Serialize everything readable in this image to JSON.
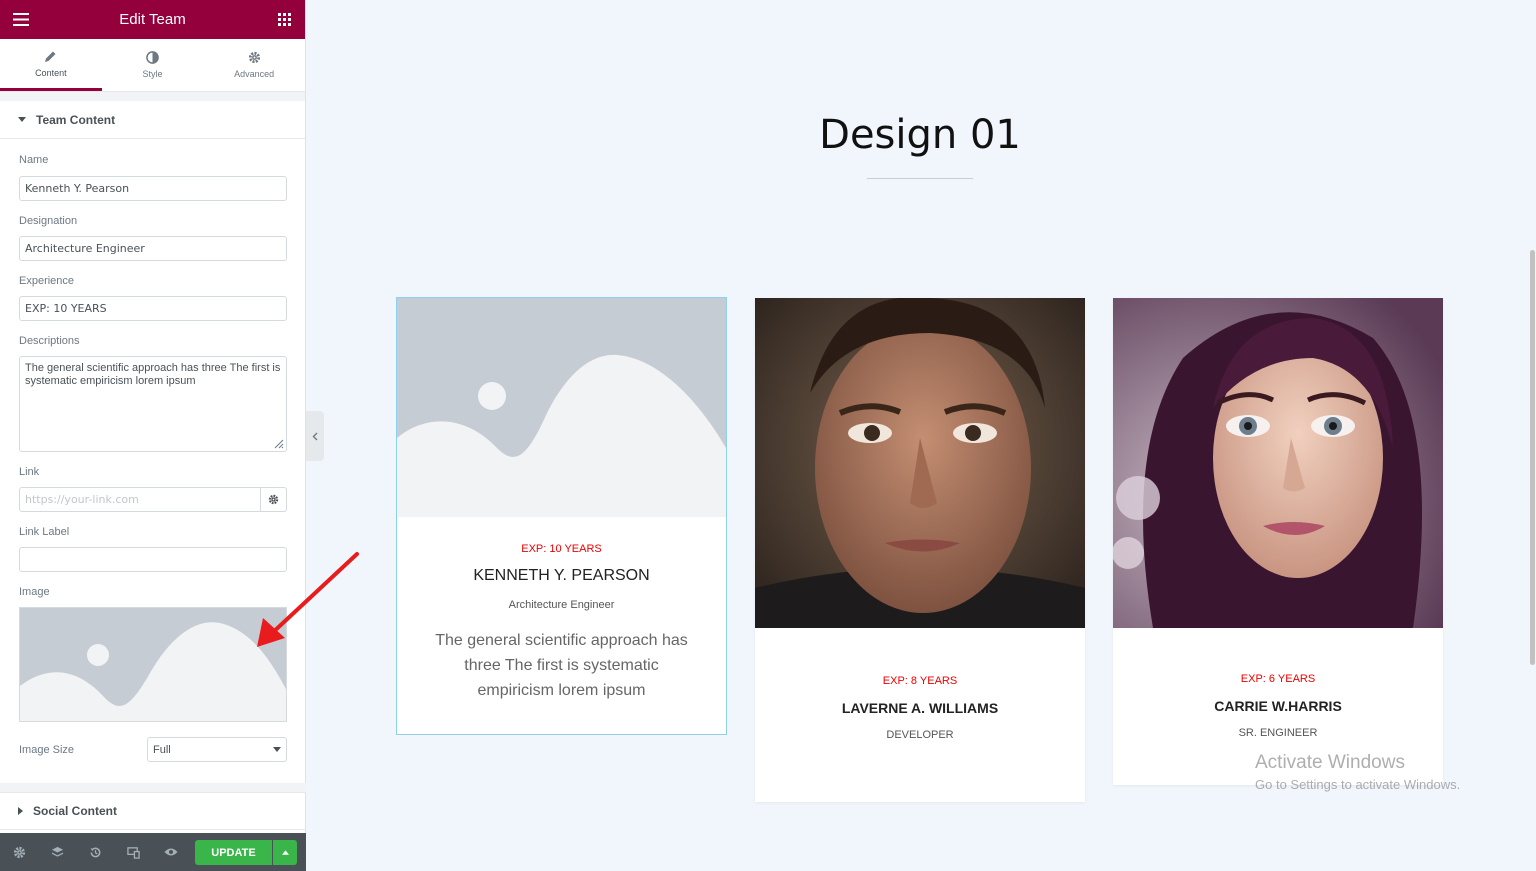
{
  "editor": {
    "title": "Edit Team",
    "tabs": [
      {
        "label": "Content"
      },
      {
        "label": "Style"
      },
      {
        "label": "Advanced"
      }
    ],
    "sections": {
      "team_content": "Team Content",
      "social_content": "Social Content"
    },
    "fields": {
      "name_label": "Name",
      "name_value": "Kenneth Y. Pearson",
      "designation_label": "Designation",
      "designation_value": "Architecture Engineer",
      "experience_label": "Experience",
      "experience_value": "EXP: 10 YEARS",
      "descriptions_label": "Descriptions",
      "descriptions_value": "The general scientific approach has three The first is systematic empiricism lorem ipsum",
      "link_label": "Link",
      "link_placeholder": "https://your-link.com",
      "link_label_label": "Link Label",
      "link_label_value": "",
      "image_label": "Image",
      "image_size_label": "Image Size",
      "image_size_value": "Full"
    },
    "footer": {
      "update_label": "UPDATE"
    },
    "accent_color": "#93003c",
    "update_color": "#39b54a"
  },
  "canvas": {
    "heading": "Design 01",
    "cards": [
      {
        "exp": "EXP: 10 YEARS",
        "name": "KENNETH Y. PEARSON",
        "role": "Architecture Engineer",
        "desc": "The general scientific approach has three The first is systematic empiricism lorem ipsum",
        "image": "placeholder"
      },
      {
        "exp": "EXP: 8 YEARS",
        "name": "LAVERNE A. WILLIAMS",
        "role": "DEVELOPER",
        "image": "man-portrait"
      },
      {
        "exp": "EXP: 6 YEARS",
        "name": "CARRIE W.HARRIS",
        "role": "SR. ENGINEER",
        "image": "woman-portrait"
      }
    ],
    "exp_color": "#ee0000"
  },
  "watermark": {
    "line1": "Activate Windows",
    "line2": "Go to Settings to activate Windows."
  }
}
